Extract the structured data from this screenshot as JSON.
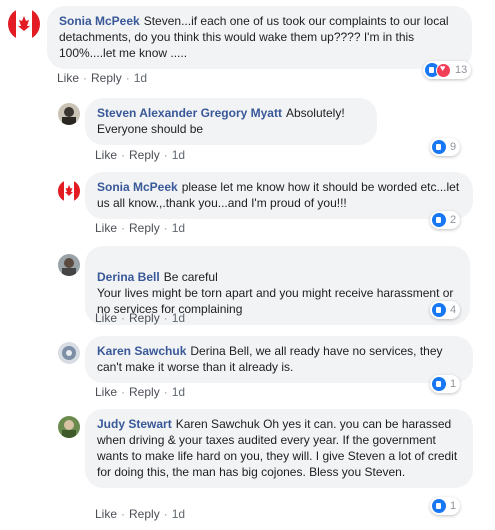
{
  "actions": {
    "like": "Like",
    "reply": "Reply",
    "sep": "·"
  },
  "comments": [
    {
      "name": "Sonia McPeek",
      "text": "Steven...if each one of us took our complaints to our local detachments, do you think this would wake them up???? I'm in this 100%....let me know .....",
      "time": "1d",
      "reactions": "13",
      "avatar": "canada-flag-avatar"
    },
    {
      "name": "Steven Alexander Gregory Myatt",
      "text": "Absolutely! Everyone should be",
      "time": "1d",
      "reactions": "9",
      "avatar": "profile-photo"
    },
    {
      "name": "Sonia McPeek",
      "text": "please let me know how it should be worded etc...let us all know.,.thank you...and I'm proud of you!!!",
      "time": "1d",
      "reactions": "2",
      "avatar": "canada-flag-avatar"
    },
    {
      "name": "Derina Bell",
      "text": "Be careful\nYour lives might be torn apart and you might receive harassment or no services for complaining",
      "time": "1d",
      "reactions": "4",
      "avatar": "profile-photo"
    },
    {
      "name": "Karen Sawchuk",
      "text": "Derina Bell, we all ready have no services, they can't make it worse than it already is.",
      "time": "1d",
      "reactions": "1",
      "avatar": "profile-photo"
    },
    {
      "name": "Judy Stewart",
      "text": "Karen Sawchuk Oh yes it can. you can be harassed when driving & your taxes audited every year. If the government wants to make life hard on you, they will. I give Steven a lot of credit for doing this, the man has big cojones. Bless you Steven.",
      "time": "1d",
      "reactions": "1",
      "avatar": "profile-photo"
    }
  ],
  "colors": {
    "name": "#385898",
    "bubble": "#f2f3f5",
    "like": "#1877f2",
    "love": "#f33e58"
  }
}
